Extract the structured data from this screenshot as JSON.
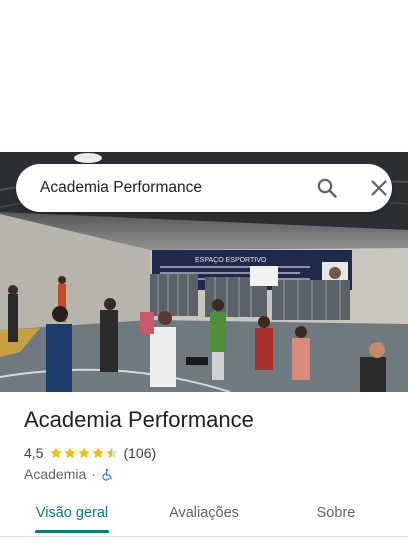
{
  "search": {
    "query": "Academia Performance",
    "search_icon": "search-icon",
    "close_icon": "close-icon"
  },
  "photo": {
    "banner_title": "ESPAÇO ESPORTIVO"
  },
  "place": {
    "name": "Academia Performance",
    "rating": "4,5",
    "stars_value": 4.5,
    "review_count": "(106)",
    "category": "Academia",
    "separator": "·",
    "accessibility_icon": "wheelchair-icon"
  },
  "tabs": [
    {
      "label": "Visão geral",
      "active": true
    },
    {
      "label": "Avaliações",
      "active": false
    },
    {
      "label": "Sobre",
      "active": false
    }
  ],
  "colors": {
    "accent": "#0b7a7a",
    "star": "#fbbc04",
    "accessibility": "#1a73e8"
  }
}
